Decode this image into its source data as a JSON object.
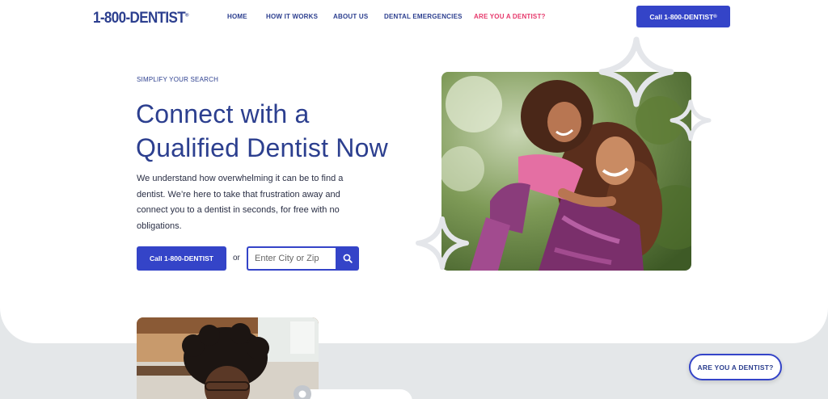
{
  "header": {
    "logo": "1-800-DENTIST",
    "logo_mark": "®",
    "nav": [
      {
        "label": "HOME"
      },
      {
        "label": "HOW IT WORKS"
      },
      {
        "label": "ABOUT US"
      },
      {
        "label": "DENTAL EMERGENCIES"
      },
      {
        "label": "ARE YOU A DENTIST?"
      }
    ],
    "cta_label": "Call 1-800-DENTIST",
    "cta_mark": "®"
  },
  "hero": {
    "eyebrow": "SIMPLIFY YOUR SEARCH",
    "headline_line1": "Connect with a",
    "headline_line2": "Qualified Dentist Now",
    "description": "We understand how overwhelming it can be to find a dentist. We’re here to take that frustration away and connect you to a dentist in seconds, for free with no obligations.",
    "call_label": "Call 1-800-DENTIST",
    "or_label": "or",
    "search_placeholder": "Enter City or Zip"
  },
  "floating": {
    "dentist_pill": "ARE YOU A DENTIST?"
  },
  "colors": {
    "brand_blue": "#3444c8",
    "navy_text": "#2c3f8f",
    "accent_pink": "#e6386b",
    "page_bg": "#e4e7e9"
  },
  "icons": [
    "search-icon",
    "sparkle-icon",
    "map-pin-icon"
  ]
}
